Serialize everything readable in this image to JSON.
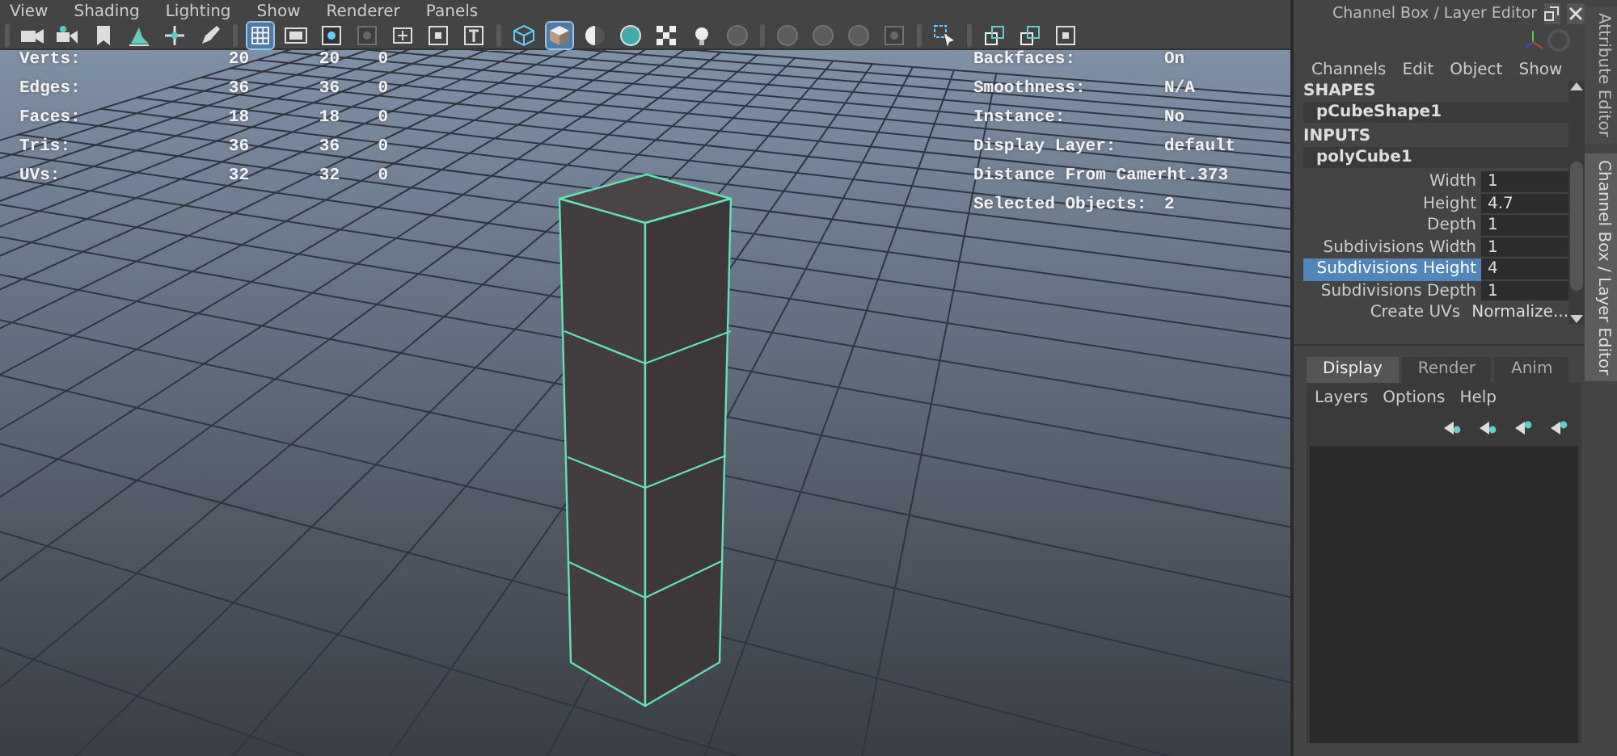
{
  "menu": [
    "View",
    "Shading",
    "Lighting",
    "Show",
    "Renderer",
    "Panels"
  ],
  "toolbar": [
    [
      {
        "kind": "camera",
        "selected": false,
        "disabled": false
      },
      {
        "kind": "camera-attr",
        "selected": false,
        "disabled": false
      },
      {
        "kind": "bookmark",
        "selected": false,
        "disabled": false
      },
      {
        "kind": "plane",
        "selected": false,
        "disabled": false
      },
      {
        "kind": "move",
        "selected": false,
        "disabled": false
      },
      {
        "kind": "pencil",
        "selected": false,
        "disabled": false
      }
    ],
    [
      {
        "kind": "grid",
        "selected": true,
        "disabled": false
      },
      {
        "kind": "film",
        "selected": false,
        "disabled": false
      },
      {
        "kind": "dot-square",
        "selected": false,
        "disabled": false
      },
      {
        "kind": "dot-square",
        "selected": false,
        "disabled": true
      },
      {
        "kind": "frame",
        "selected": false,
        "disabled": false
      },
      {
        "kind": "small-frame",
        "selected": false,
        "disabled": false
      },
      {
        "kind": "text-box",
        "selected": false,
        "disabled": false
      }
    ],
    [
      {
        "kind": "wire-cube",
        "selected": false,
        "disabled": false
      },
      {
        "kind": "shaded-cube",
        "selected": true,
        "disabled": false
      },
      {
        "kind": "half-circle",
        "selected": false,
        "disabled": false
      },
      {
        "kind": "sphere",
        "selected": false,
        "disabled": false
      },
      {
        "kind": "checker",
        "selected": false,
        "disabled": false
      },
      {
        "kind": "light",
        "selected": false,
        "disabled": false
      },
      {
        "kind": "sphere",
        "selected": false,
        "disabled": true
      }
    ],
    [
      {
        "kind": "sphere",
        "selected": false,
        "disabled": true
      },
      {
        "kind": "sphere",
        "selected": false,
        "disabled": true
      },
      {
        "kind": "sphere",
        "selected": false,
        "disabled": true
      },
      {
        "kind": "dot-square",
        "selected": false,
        "disabled": true
      }
    ],
    [
      {
        "kind": "select",
        "selected": false,
        "disabled": false
      }
    ],
    [
      {
        "kind": "windows",
        "selected": false,
        "disabled": false
      },
      {
        "kind": "windows",
        "selected": false,
        "disabled": false
      },
      {
        "kind": "small-frame",
        "selected": false,
        "disabled": false
      }
    ]
  ],
  "hud_stats": [
    {
      "label": "Verts:",
      "values": [
        "20",
        "20",
        "0"
      ]
    },
    {
      "label": "Edges:",
      "values": [
        "36",
        "36",
        "0"
      ]
    },
    {
      "label": "Faces:",
      "values": [
        "18",
        "18",
        "0"
      ]
    },
    {
      "label": "Tris:",
      "values": [
        "36",
        "36",
        "0"
      ]
    },
    {
      "label": "UVs:",
      "values": [
        "32",
        "32",
        "0"
      ]
    }
  ],
  "hud_info": [
    {
      "label": "Backfaces:",
      "value": "On"
    },
    {
      "label": "Smoothness:",
      "value": "N/A"
    },
    {
      "label": "Instance:",
      "value": "No"
    },
    {
      "label": "Display Layer:",
      "value": "default"
    },
    {
      "label": "Distance From Camerht.373"
    },
    {
      "label": "Selected Objects:",
      "value": "2"
    }
  ],
  "channel_box": {
    "title": "Channel Box / Layer Editor",
    "menu": [
      "Channels",
      "Edit",
      "Object",
      "Show"
    ],
    "shapes_heading": "SHAPES",
    "shape": "pCubeShape1",
    "inputs_heading": "INPUTS",
    "input": "polyCube1",
    "attributes": [
      {
        "name": "Width",
        "value": "1",
        "selected": false
      },
      {
        "name": "Height",
        "value": "4.7",
        "selected": false
      },
      {
        "name": "Depth",
        "value": "1",
        "selected": false
      },
      {
        "name": "Subdivisions Width",
        "value": "1",
        "selected": false
      },
      {
        "name": "Subdivisions Height",
        "value": "4",
        "selected": true
      },
      {
        "name": "Subdivisions Depth",
        "value": "1",
        "selected": false
      },
      {
        "name": "Create UVs",
        "value": "Normalize...",
        "selected": false
      }
    ]
  },
  "layer_editor": {
    "tabs": [
      {
        "label": "Display",
        "selected": true
      },
      {
        "label": "Render",
        "selected": false
      },
      {
        "label": "Anim",
        "selected": false
      }
    ],
    "menu": [
      "Layers",
      "Options",
      "Help"
    ]
  },
  "side_tabs": [
    {
      "label": "Attribute Editor",
      "selected": false
    },
    {
      "label": "Channel Box / Layer Editor",
      "selected": true
    }
  ]
}
